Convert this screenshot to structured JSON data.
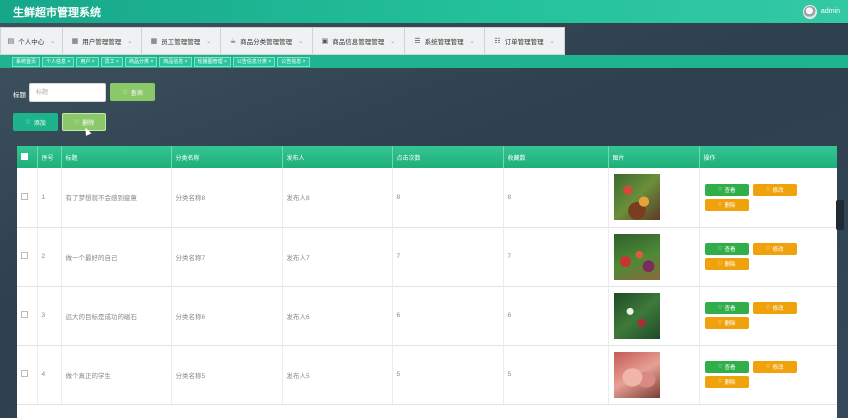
{
  "header": {
    "title": "生鲜超市管理系统",
    "username": "admin"
  },
  "menu": [
    {
      "icon": "▤",
      "label": "个人中心",
      "w": 63
    },
    {
      "icon": "▦",
      "label": "用户管理管理",
      "w": 79
    },
    {
      "icon": "▦",
      "label": "员工管理管理",
      "w": 79
    },
    {
      "icon": "☕",
      "label": "商品分类管理管理",
      "w": 92
    },
    {
      "icon": "▣",
      "label": "商品信息管理管理",
      "w": 92
    },
    {
      "icon": "☰",
      "label": "系统管理管理",
      "w": 80
    },
    {
      "icon": "☷",
      "label": "订单管理管理",
      "w": 80
    }
  ],
  "tabs": [
    "系统首页",
    "个人信息 ×",
    "用户 ×",
    "员工 ×",
    "商品分类 ×",
    "商品信息 ×",
    "轮播图管理 ×",
    "公告信息分类 ×",
    "公告信息 ×"
  ],
  "search": {
    "label": "标题",
    "placeholder": "标题",
    "query_button": "查询"
  },
  "actions": {
    "add_button": "添加",
    "delete_button": "删除"
  },
  "table": {
    "headers": [
      "",
      "序号",
      "标题",
      "分类名称",
      "发布人",
      "点击次数",
      "收藏数",
      "图片",
      "操作"
    ],
    "rows": [
      {
        "index": "1",
        "title": "有了梦想就不会感到疲惫",
        "category": "分类名称8",
        "publisher": "发布人8",
        "clicks": "8",
        "favorites": "8",
        "image": "t1"
      },
      {
        "index": "2",
        "title": "做一个最好的自己",
        "category": "分类名称7",
        "publisher": "发布人7",
        "clicks": "7",
        "favorites": "7",
        "image": "t2"
      },
      {
        "index": "3",
        "title": "远大的目标是成功的磁石",
        "category": "分类名称6",
        "publisher": "发布人6",
        "clicks": "6",
        "favorites": "6",
        "image": "t3"
      },
      {
        "index": "4",
        "title": "做个真正的学生",
        "category": "分类名称5",
        "publisher": "发布人5",
        "clicks": "5",
        "favorites": "5",
        "image": "t4"
      }
    ],
    "op_labels": {
      "view": "查看",
      "edit": "修改",
      "delete": "删除"
    }
  }
}
